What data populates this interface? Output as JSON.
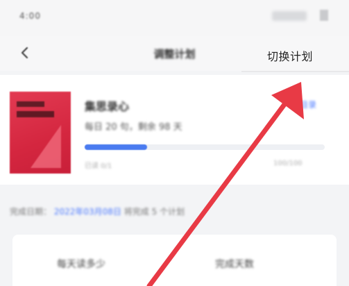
{
  "status_bar": {
    "time": "4:00"
  },
  "nav": {
    "title": "调整计划",
    "switch_plan": "切换计划"
  },
  "book": {
    "title": "集思录心",
    "subtitle": "每日 20 句，剩余 98 天",
    "directory": "目录",
    "progress": 0.26,
    "progress_left": "已读 0/1",
    "progress_right": "100/100"
  },
  "plan_info": {
    "prefix": "完成日期：",
    "date": "2022年03月08日",
    "suffix": "将完成 5 个计划"
  },
  "options": {
    "option_a": "每天读多少",
    "option_b": "完成天数"
  },
  "colors": {
    "accent": "#4a7bf0",
    "cover": "#d4263f",
    "arrow": "#e83a45"
  }
}
